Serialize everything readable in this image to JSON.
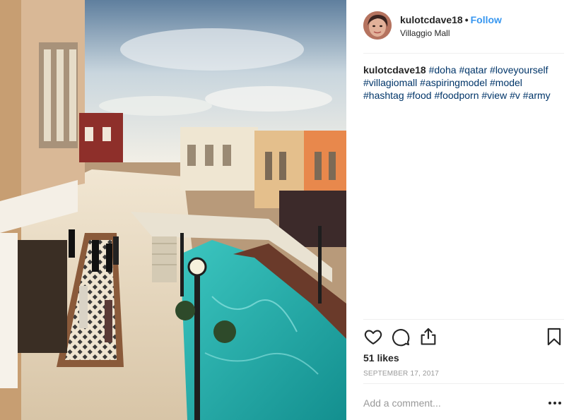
{
  "post": {
    "username": "kulotcdave18",
    "separator": "•",
    "follow_label": "Follow",
    "location": "Villaggio Mall",
    "caption_user": "kulotcdave18",
    "hashtags": [
      "#doha",
      "#qatar",
      "#loveyourself",
      "#villagiomall",
      "#aspiringmodel",
      "#model",
      "#hashtag",
      "#food",
      "#foodporn",
      "#view",
      "#v",
      "#army"
    ],
    "likes": "51 likes",
    "date": "SEPTEMBER 17, 2017",
    "comment_placeholder": "Add a comment...",
    "photo_alt": "Villaggio Mall canal"
  },
  "icons": {
    "like": "heart-icon",
    "comment": "comment-icon",
    "share": "share-icon",
    "save": "bookmark-icon",
    "more": "more-dots-icon"
  },
  "colors": {
    "follow": "#3897f0",
    "hashtag": "#003569",
    "muted": "#999999",
    "canal": "#2bb5b0"
  }
}
